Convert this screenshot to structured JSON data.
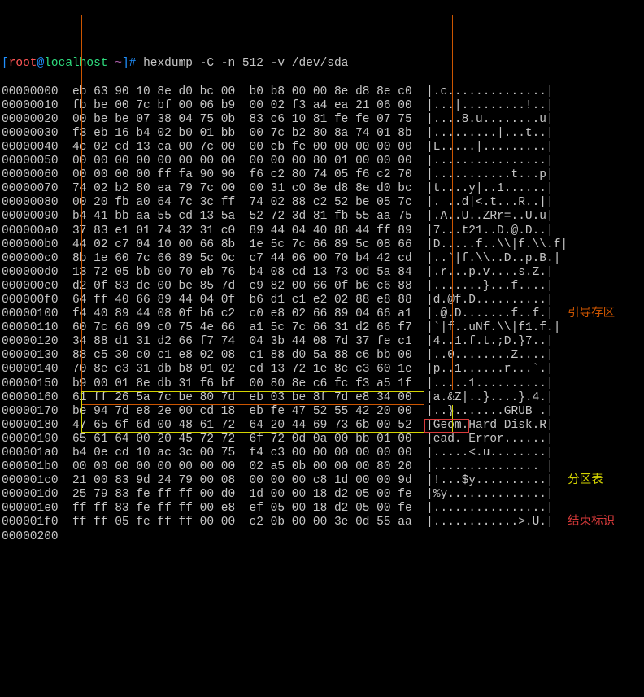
{
  "prompt": {
    "user": "root",
    "host": "localhost",
    "path": "~",
    "command": "hexdump -C -n 512 -v /dev/sda"
  },
  "labels": {
    "boot": "引导存区",
    "part": "分区表",
    "end": "结束标识"
  },
  "rows": [
    {
      "o": "00000000",
      "h": "eb 63 90 10 8e d0 bc 00  b0 b8 00 00 8e d8 8e c0",
      "a": "|.c..............|"
    },
    {
      "o": "00000010",
      "h": "fb be 00 7c bf 00 06 b9  00 02 f3 a4 ea 21 06 00",
      "a": "|...|.........!..|"
    },
    {
      "o": "00000020",
      "h": "00 be be 07 38 04 75 0b  83 c6 10 81 fe fe 07 75",
      "a": "|....8.u........u|"
    },
    {
      "o": "00000030",
      "h": "f3 eb 16 b4 02 b0 01 bb  00 7c b2 80 8a 74 01 8b",
      "a": "|.........|...t..|"
    },
    {
      "o": "00000040",
      "h": "4c 02 cd 13 ea 00 7c 00  00 eb fe 00 00 00 00 00",
      "a": "|L.....|.........|"
    },
    {
      "o": "00000050",
      "h": "00 00 00 00 00 00 00 00  00 00 00 80 01 00 00 00",
      "a": "|................|"
    },
    {
      "o": "00000060",
      "h": "00 00 00 00 ff fa 90 90  f6 c2 80 74 05 f6 c2 70",
      "a": "|...........t...p|"
    },
    {
      "o": "00000070",
      "h": "74 02 b2 80 ea 79 7c 00  00 31 c0 8e d8 8e d0 bc",
      "a": "|t....y|..1......|"
    },
    {
      "o": "00000080",
      "h": "00 20 fb a0 64 7c 3c ff  74 02 88 c2 52 be 05 7c",
      "a": "|. ..d|<.t...R..||"
    },
    {
      "o": "00000090",
      "h": "b4 41 bb aa 55 cd 13 5a  52 72 3d 81 fb 55 aa 75",
      "a": "|.A..U..ZRr=..U.u|"
    },
    {
      "o": "000000a0",
      "h": "37 83 e1 01 74 32 31 c0  89 44 04 40 88 44 ff 89",
      "a": "|7...t21..D.@.D..|"
    },
    {
      "o": "000000b0",
      "h": "44 02 c7 04 10 00 66 8b  1e 5c 7c 66 89 5c 08 66",
      "a": "|D.....f..\\\\|f.\\\\.f|"
    },
    {
      "o": "000000c0",
      "h": "8b 1e 60 7c 66 89 5c 0c  c7 44 06 00 70 b4 42 cd",
      "a": "|..`|f.\\\\..D..p.B.|"
    },
    {
      "o": "000000d0",
      "h": "13 72 05 bb 00 70 eb 76  b4 08 cd 13 73 0d 5a 84",
      "a": "|.r...p.v....s.Z.|"
    },
    {
      "o": "000000e0",
      "h": "d2 0f 83 de 00 be 85 7d  e9 82 00 66 0f b6 c6 88",
      "a": "|.......}...f....|"
    },
    {
      "o": "000000f0",
      "h": "64 ff 40 66 89 44 04 0f  b6 d1 c1 e2 02 88 e8 88",
      "a": "|d.@f.D..........|"
    },
    {
      "o": "00000100",
      "h": "f4 40 89 44 08 0f b6 c2  c0 e8 02 66 89 04 66 a1",
      "a": "|.@.D.......f..f.|"
    },
    {
      "o": "00000110",
      "h": "60 7c 66 09 c0 75 4e 66  a1 5c 7c 66 31 d2 66 f7",
      "a": "|`|f..uNf.\\\\|f1.f.|"
    },
    {
      "o": "00000120",
      "h": "34 88 d1 31 d2 66 f7 74  04 3b 44 08 7d 37 fe c1",
      "a": "|4..1.f.t.;D.}7..|"
    },
    {
      "o": "00000130",
      "h": "88 c5 30 c0 c1 e8 02 08  c1 88 d0 5a 88 c6 bb 00",
      "a": "|..0........Z....|"
    },
    {
      "o": "00000140",
      "h": "70 8e c3 31 db b8 01 02  cd 13 72 1e 8c c3 60 1e",
      "a": "|p..1......r...`.|"
    },
    {
      "o": "00000150",
      "h": "b9 00 01 8e db 31 f6 bf  00 80 8e c6 fc f3 a5 1f",
      "a": "|.....1..........|"
    },
    {
      "o": "00000160",
      "h": "61 ff 26 5a 7c be 80 7d  eb 03 be 8f 7d e8 34 00",
      "a": "|a.&Z|..}....}.4.|"
    },
    {
      "o": "00000170",
      "h": "be 94 7d e8 2e 00 cd 18  eb fe 47 52 55 42 20 00",
      "a": "|..}.......GRUB .|"
    },
    {
      "o": "00000180",
      "h": "47 65 6f 6d 00 48 61 72  64 20 44 69 73 6b 00 52",
      "a": "|Geom.Hard Disk.R|"
    },
    {
      "o": "00000190",
      "h": "65 61 64 00 20 45 72 72  6f 72 0d 0a 00 bb 01 00",
      "a": "|ead. Error......|"
    },
    {
      "o": "000001a0",
      "h": "b4 0e cd 10 ac 3c 00 75  f4 c3 00 00 00 00 00 00",
      "a": "|.....<.u........|"
    },
    {
      "o": "000001b0",
      "h": "00 00 00 00 00 00 00 00  02 a5 0b 00 00 00 80 20",
      "a": "|............... |"
    },
    {
      "o": "000001c0",
      "h": "21 00 83 9d 24 79 00 08  00 00 00 c8 1d 00 00 9d",
      "a": "|!...$y..........|"
    },
    {
      "o": "000001d0",
      "h": "25 79 83 fe ff ff 00 d0  1d 00 00 18 d2 05 00 fe",
      "a": "|%y..............|"
    },
    {
      "o": "000001e0",
      "h": "ff ff 83 fe ff ff 00 e8  ef 05 00 18 d2 05 00 fe",
      "a": "|................|"
    },
    {
      "o": "000001f0",
      "h": "ff ff 05 fe ff ff 00 00  c2 0b 00 00 3e 0d 55 aa",
      "a": "|............>.U.|"
    },
    {
      "o": "00000200",
      "h": "",
      "a": ""
    }
  ]
}
